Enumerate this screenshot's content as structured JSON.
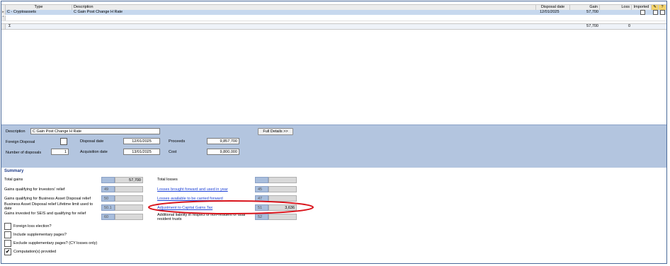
{
  "grid": {
    "headers": {
      "type": "Type",
      "description": "Description",
      "disposal_date": "Disposal date",
      "gain": "Gain",
      "loss": "Loss",
      "imported": "Imported",
      "help": "?"
    },
    "rows": [
      {
        "type": "C - Cryptoassets",
        "description": "C Gain Post Change H Rate",
        "disposal_date": "12/01/2025",
        "gain": "57,700"
      }
    ],
    "totals": {
      "symbol": "Σ",
      "gain": "57,700",
      "loss": "0"
    }
  },
  "detail": {
    "description_label": "Description",
    "description_value": "C Gain Post Change H Rate",
    "full_details_button": "Full Details >>",
    "foreign_disposal_label": "Foreign Disposal",
    "disposal_date_label": "Disposal date",
    "disposal_date_value": "12/01/2025",
    "proceeds_label": "Proceeds",
    "proceeds_value": "9,857,700",
    "number_of_disposals_label": "Number of disposals",
    "number_of_disposals_value": "1",
    "acquisition_date_label": "Acquisition date",
    "acquisition_date_value": "13/01/2025",
    "cost_label": "Cost",
    "cost_value": "9,800,000"
  },
  "summary": {
    "title": "Summary",
    "left": [
      {
        "label": "Total gains",
        "code": "",
        "value": "57,700"
      },
      {
        "label": "Gains qualifying for Investors' relief",
        "code": "49",
        "value": ""
      },
      {
        "label": "Gains qualifying for Business Asset Disposal relief",
        "code": "50",
        "value": ""
      },
      {
        "label": "Business Asset Disposal relief Lifetime limit used to date",
        "code": "50.1",
        "value": ""
      },
      {
        "label": "Gains invested for SEIS and qualifying for relief",
        "code": "60",
        "value": ""
      }
    ],
    "right": [
      {
        "label": "Total losses",
        "code": "",
        "value": ""
      },
      {
        "label": "Losses brought forward and used in year",
        "code": "45",
        "value": ""
      },
      {
        "label": "Losses available to be carried forward",
        "code": "47",
        "value": ""
      },
      {
        "label": "Adjustment to Capital Gains Tax",
        "code": "51",
        "value": "3,636"
      },
      {
        "label": "Additional liability in respect of non-resident or dual resident trusts",
        "code": "52",
        "value": ""
      }
    ],
    "checkboxes": [
      {
        "label": "Foreign loss election?",
        "checked": false
      },
      {
        "label": "Include supplementary pages?",
        "checked": false
      },
      {
        "label": "Exclude supplementary pages? (CY losses only)",
        "checked": false
      },
      {
        "label": "Computation(s) provided",
        "checked": true
      }
    ]
  },
  "colors": {
    "highlight_ellipse": "#d9141c",
    "panel_bg": "#b3c5df",
    "link": "#1a3fd6"
  }
}
